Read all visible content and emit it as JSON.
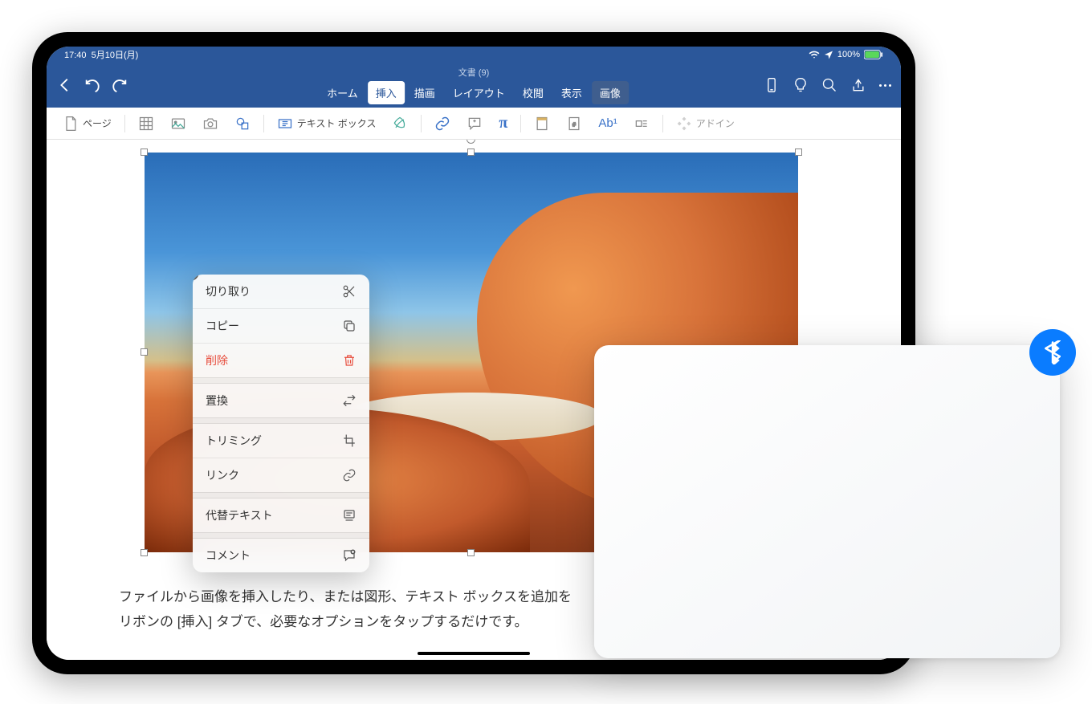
{
  "status": {
    "time": "17:40",
    "date": "5月10日(月)",
    "battery": "100%"
  },
  "header": {
    "doc_title": "文書 (9)",
    "tabs": {
      "home": "ホーム",
      "insert": "挿入",
      "draw": "描画",
      "layout": "レイアウト",
      "review": "校閲",
      "view": "表示",
      "picture": "画像"
    }
  },
  "ribbon": {
    "page": "ページ",
    "textbox": "テキスト ボックス",
    "addin": "アドイン"
  },
  "context_menu": {
    "cut": "切り取り",
    "copy": "コピー",
    "delete": "削除",
    "replace": "置換",
    "crop": "トリミング",
    "link": "リンク",
    "alt_text": "代替テキスト",
    "comment": "コメント"
  },
  "body": {
    "line1": "ファイルから画像を挿入したり、または図形、テキスト ボックスを追加を",
    "line2": "リボンの [挿入] タブで、必要なオプションをタップするだけです。"
  }
}
